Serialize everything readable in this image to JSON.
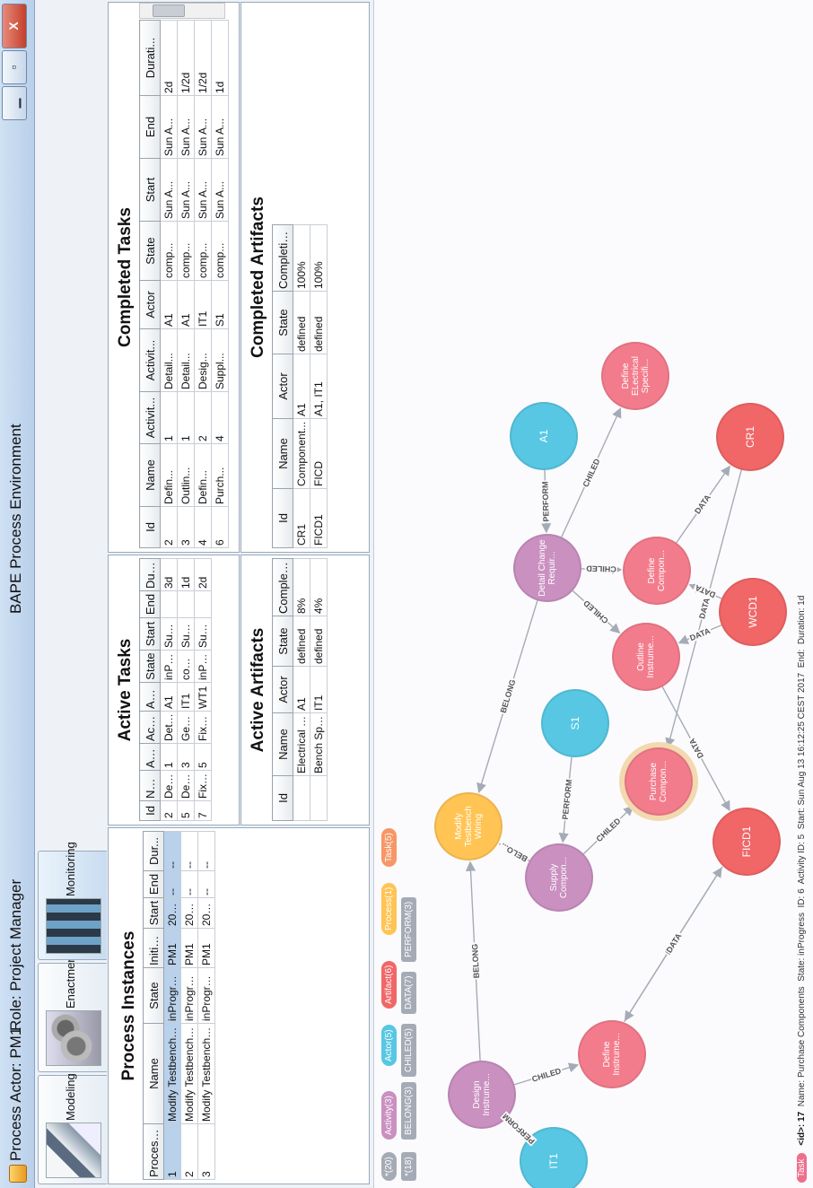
{
  "window": {
    "actor": "Process Actor: PM1",
    "role": "Role: Project Manager",
    "app_title": "BAPE Process Environment",
    "min_label": "▁",
    "max_label": "▫",
    "close_label": "X"
  },
  "tabs": [
    {
      "label": "Modeling",
      "icon": "modeling-icon"
    },
    {
      "label": "Enactment",
      "icon": "enactment-icon"
    },
    {
      "label": "Monitoring",
      "icon": "monitoring-icon"
    }
  ],
  "process_instances": {
    "title": "Process Instances",
    "columns": [
      "ProcessID",
      "Name",
      "State",
      "Initiator",
      "Start",
      "End",
      "Dur..."
    ],
    "rows": [
      [
        "1",
        "Modify Testbench Wiring",
        "inProgress",
        "PM1",
        "201...",
        "--",
        "--"
      ],
      [
        "2",
        "Modify Testbench Wiring",
        "inProgress",
        "PM1",
        "201...",
        "--",
        "--"
      ],
      [
        "3",
        "Modify Testbench Wiring",
        "inProgress",
        "PM1",
        "201...",
        "--",
        "--"
      ]
    ]
  },
  "active_tasks": {
    "title": "Active Tasks",
    "columns": [
      "Id",
      "Name",
      "Activit...",
      "Activit...",
      "Actor",
      "State",
      "Start",
      "End",
      "Durat..."
    ],
    "rows": [
      [
        "2",
        "Defin...",
        "1",
        "Detai...",
        "A1",
        "inPro...",
        "Sun ...",
        "",
        "3d"
      ],
      [
        "5",
        "Defin...",
        "3",
        "Gene...",
        "IT1",
        "com...",
        "Sun ...",
        "",
        "1d"
      ],
      [
        "7",
        "Fix C...",
        "5",
        "Fix a...",
        "WT1",
        "inPro...",
        "Sun ...",
        "",
        "2d"
      ]
    ]
  },
  "completed_tasks": {
    "title": "Completed Tasks",
    "columns": [
      "Id",
      "Name",
      "Activit...",
      "Activit...",
      "Actor",
      "State",
      "Start",
      "End",
      "Durati..."
    ],
    "rows": [
      [
        "2",
        "Defin...",
        "1",
        "Detail...",
        "A1",
        "comp...",
        "Sun A...",
        "Sun A...",
        "2d"
      ],
      [
        "3",
        "Outlin...",
        "1",
        "Detail...",
        "A1",
        "comp...",
        "Sun A...",
        "Sun A...",
        "1/2d"
      ],
      [
        "4",
        "Defin...",
        "2",
        "Desig...",
        "IT1",
        "comp...",
        "Sun A...",
        "Sun A...",
        "1/2d"
      ],
      [
        "6",
        "Purch...",
        "4",
        "Suppl...",
        "S1",
        "comp...",
        "Sun A...",
        "Sun A...",
        "1d"
      ]
    ]
  },
  "active_artifacts": {
    "title": "Active Artifacts",
    "columns": [
      "Id",
      "Name",
      "Actor",
      "State",
      "Completion..."
    ],
    "rows": [
      [
        "",
        "Electrical S...",
        "A1",
        "defined",
        "8%"
      ],
      [
        "",
        "Bench Spe...",
        "IT1",
        "defined",
        "4%"
      ]
    ]
  },
  "completed_artifacts": {
    "title": "Completed Artifacts",
    "columns": [
      "Id",
      "Name",
      "Actor",
      "State",
      "Completion..."
    ],
    "rows": [
      [
        "CR1",
        "Component...",
        "A1",
        "defined",
        "100%"
      ],
      [
        "FICD1",
        "FICD",
        "A1, IT1",
        "defined",
        "100%"
      ]
    ]
  },
  "graph": {
    "legend_nodes": [
      {
        "label": "*(20)",
        "color": "#a5abb6"
      },
      {
        "label": "Activity(3)",
        "color": "#c990c0"
      },
      {
        "label": "Actor(5)",
        "color": "#57c7e3"
      },
      {
        "label": "Artifact(6)",
        "color": "#f16667"
      },
      {
        "label": "Process(1)",
        "color": "#ffc454"
      },
      {
        "label": "Task(5)",
        "color": "#f79767"
      }
    ],
    "legend_rels": [
      {
        "label": "*(18)"
      },
      {
        "label": "BELONG(3)"
      },
      {
        "label": "CHILED(5)"
      },
      {
        "label": "DATA(7)"
      },
      {
        "label": "PERFORM(3)"
      }
    ],
    "nodes": [
      {
        "id": "modify",
        "label": "Modify Testbench Wiring",
        "kind": "process",
        "color": "#ffc454"
      },
      {
        "id": "design",
        "label": "Design Instrume...",
        "kind": "activity",
        "color": "#c990c0"
      },
      {
        "id": "supply",
        "label": "Supply Compon...",
        "kind": "activity",
        "color": "#c990c0"
      },
      {
        "id": "detail",
        "label": "Detail Change Requir...",
        "kind": "activity",
        "color": "#c990c0"
      },
      {
        "id": "it1",
        "label": "IT1",
        "kind": "actor",
        "color": "#57c7e3"
      },
      {
        "id": "s1",
        "label": "S1",
        "kind": "actor",
        "color": "#57c7e3"
      },
      {
        "id": "a1",
        "label": "A1",
        "kind": "actor",
        "color": "#57c7e3"
      },
      {
        "id": "defineinst",
        "label": "Define Instrume...",
        "kind": "task",
        "color": "#f37c8c"
      },
      {
        "id": "purchase",
        "label": "Purchase Compon...",
        "kind": "task",
        "color": "#f37c8c"
      },
      {
        "id": "outline",
        "label": "Outline Instrume...",
        "kind": "task",
        "color": "#f37c8c"
      },
      {
        "id": "definecomp",
        "label": "Define Compon...",
        "kind": "task",
        "color": "#f37c8c"
      },
      {
        "id": "defineelec",
        "label": "Define ELectrical Specifi...",
        "kind": "task",
        "color": "#f37c8c"
      },
      {
        "id": "ficd1",
        "label": "FICD1",
        "kind": "artifact",
        "color": "#f16667"
      },
      {
        "id": "wcd1",
        "label": "WCD1",
        "kind": "artifact",
        "color": "#f16667"
      },
      {
        "id": "cr1",
        "label": "CR1",
        "kind": "artifact",
        "color": "#f16667"
      }
    ],
    "edges": [
      {
        "from": "it1",
        "to": "design",
        "label": "PERFORM"
      },
      {
        "from": "design",
        "to": "modify",
        "label": "BELONG"
      },
      {
        "from": "design",
        "to": "defineinst",
        "label": "CHILED"
      },
      {
        "from": "supply",
        "to": "modify",
        "label": "BELO..."
      },
      {
        "from": "s1",
        "to": "supply",
        "label": "PERFORM"
      },
      {
        "from": "supply",
        "to": "purchase",
        "label": "CHILED"
      },
      {
        "from": "detail",
        "to": "modify",
        "label": "BELONG"
      },
      {
        "from": "a1",
        "to": "detail",
        "label": "PERFORM"
      },
      {
        "from": "detail",
        "to": "outline",
        "label": "CHILED"
      },
      {
        "from": "detail",
        "to": "definecomp",
        "label": "CHILED"
      },
      {
        "from": "detail",
        "to": "defineelec",
        "label": "CHILED"
      },
      {
        "from": "defineinst",
        "to": "ficd1",
        "label": "DATA"
      },
      {
        "from": "ficd1",
        "to": "defineinst",
        "label": "DATA"
      },
      {
        "from": "outline",
        "to": "ficd1",
        "label": "DATA"
      },
      {
        "from": "wcd1",
        "to": "outline",
        "label": "DATA"
      },
      {
        "from": "wcd1",
        "to": "definecomp",
        "label": "DATA"
      },
      {
        "from": "definecomp",
        "to": "cr1",
        "label": "DATA"
      },
      {
        "from": "cr1",
        "to": "purchase",
        "label": "DATA"
      }
    ],
    "status": {
      "tag": "Task",
      "id": "<id>: 17",
      "name": "Name: Purchase Components",
      "state": "State: inProgress",
      "iid": "ID: 6",
      "activity": "Activity ID: 5",
      "start": "Start: Sun Aug 13 16:12:25 CEST 2017",
      "end": "End:",
      "duration": "Duration: 1d"
    }
  }
}
